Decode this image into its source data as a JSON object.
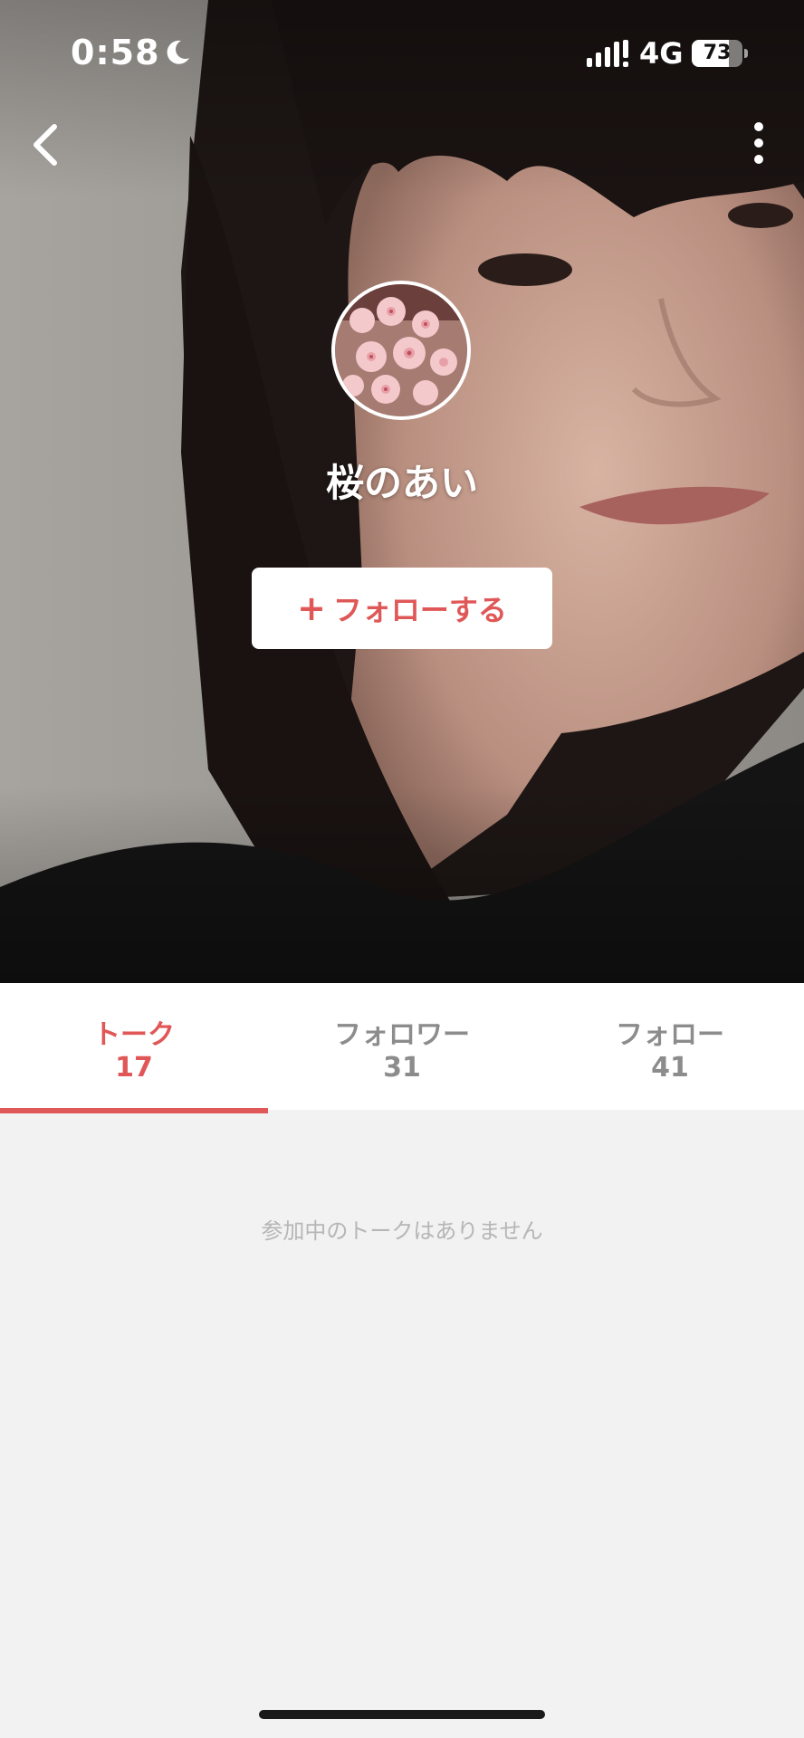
{
  "status_bar": {
    "time": "0:58",
    "network": "4G",
    "battery": 73,
    "battery_text": "73",
    "icons": [
      "moon-icon",
      "signal-icon",
      "battery-icon"
    ]
  },
  "nav": {
    "back_icon": "chevron-left-icon",
    "more_icon": "vertical-ellipsis-icon"
  },
  "profile": {
    "name": "桜のあい",
    "avatar_subject": "cherry blossoms",
    "follow_button": {
      "plus": "+",
      "label": "フォローする"
    }
  },
  "tabs": [
    {
      "label": "トーク",
      "count": "17",
      "active": true
    },
    {
      "label": "フォロワー",
      "count": "31",
      "active": false
    },
    {
      "label": "フォロー",
      "count": "41",
      "active": false
    }
  ],
  "content": {
    "empty_message": "参加中のトークはありません"
  },
  "colors": {
    "accent": "#e05757",
    "inactive": "#8c8c8c",
    "background": "#f2f2f2",
    "muted_text": "#b6b6b6"
  }
}
